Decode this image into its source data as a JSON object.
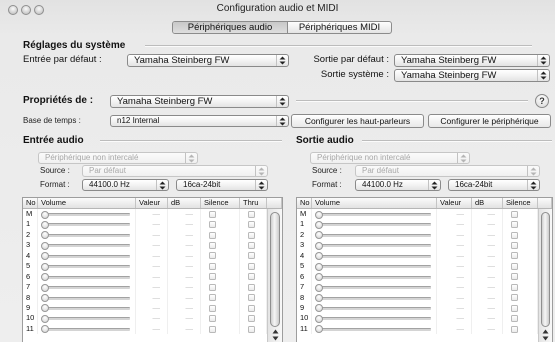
{
  "window": {
    "title": "Configuration audio et MIDI"
  },
  "tabs": [
    {
      "label": "Périphériques audio",
      "selected": true
    },
    {
      "label": "Périphériques MIDI",
      "selected": false
    }
  ],
  "system_settings": {
    "heading": "Réglages du système",
    "default_input": {
      "label": "Entrée par défaut :",
      "value": "Yamaha Steinberg FW"
    },
    "default_output": {
      "label": "Sortie par défaut :",
      "value": "Yamaha Steinberg FW"
    },
    "system_output": {
      "label": "Sortie système :",
      "value": "Yamaha Steinberg FW"
    }
  },
  "properties": {
    "label": "Propriétés de :",
    "device": "Yamaha Steinberg FW",
    "help_label": "?",
    "clock": {
      "label": "Base de temps :",
      "value": "n12 Internal"
    },
    "speakers_button": "Configurer les haut-parleurs",
    "device_button": "Configurer le périphérique"
  },
  "input": {
    "heading": "Entrée audio",
    "stream": {
      "value": "Périphérique non intercalé",
      "enabled": false
    },
    "source": {
      "label": "Source :",
      "value": "Par défaut",
      "enabled": false
    },
    "format": {
      "label": "Format :",
      "rate": "44100.0 Hz",
      "bits": "16ca-24bit"
    },
    "columns": [
      "No",
      "Volume",
      "Valeur",
      "dB",
      "Silence",
      "Thru"
    ],
    "channels": [
      {
        "no": "M",
        "volume": 0,
        "value": "—",
        "db": "—",
        "mute": false,
        "thru": false
      },
      {
        "no": "1",
        "volume": 0,
        "value": "—",
        "db": "—",
        "mute": false,
        "thru": false
      },
      {
        "no": "2",
        "volume": 0,
        "value": "—",
        "db": "—",
        "mute": false,
        "thru": false
      },
      {
        "no": "3",
        "volume": 0,
        "value": "—",
        "db": "—",
        "mute": false,
        "thru": false
      },
      {
        "no": "4",
        "volume": 0,
        "value": "—",
        "db": "—",
        "mute": false,
        "thru": false
      },
      {
        "no": "5",
        "volume": 0,
        "value": "—",
        "db": "—",
        "mute": false,
        "thru": false
      },
      {
        "no": "6",
        "volume": 0,
        "value": "—",
        "db": "—",
        "mute": false,
        "thru": false
      },
      {
        "no": "7",
        "volume": 0,
        "value": "—",
        "db": "—",
        "mute": false,
        "thru": false
      },
      {
        "no": "8",
        "volume": 0,
        "value": "—",
        "db": "—",
        "mute": false,
        "thru": false
      },
      {
        "no": "9",
        "volume": 0,
        "value": "—",
        "db": "—",
        "mute": false,
        "thru": false
      },
      {
        "no": "10",
        "volume": 0,
        "value": "—",
        "db": "—",
        "mute": false,
        "thru": false
      },
      {
        "no": "11",
        "volume": 0,
        "value": "—",
        "db": "—",
        "mute": false,
        "thru": false
      }
    ]
  },
  "output": {
    "heading": "Sortie audio",
    "stream": {
      "value": "Périphérique non intercalé",
      "enabled": false
    },
    "source": {
      "label": "Source :",
      "value": "Par défaut",
      "enabled": false
    },
    "format": {
      "label": "Format :",
      "rate": "44100.0 Hz",
      "bits": "16ca-24bit"
    },
    "columns": [
      "No",
      "Volume",
      "Valeur",
      "dB",
      "Silence"
    ],
    "channels": [
      {
        "no": "M",
        "volume": 0,
        "value": "—",
        "db": "—",
        "mute": false
      },
      {
        "no": "1",
        "volume": 0,
        "value": "—",
        "db": "—",
        "mute": false
      },
      {
        "no": "2",
        "volume": 0,
        "value": "—",
        "db": "—",
        "mute": false
      },
      {
        "no": "3",
        "volume": 0,
        "value": "—",
        "db": "—",
        "mute": false
      },
      {
        "no": "4",
        "volume": 0,
        "value": "—",
        "db": "—",
        "mute": false
      },
      {
        "no": "5",
        "volume": 0,
        "value": "—",
        "db": "—",
        "mute": false
      },
      {
        "no": "6",
        "volume": 0,
        "value": "—",
        "db": "—",
        "mute": false
      },
      {
        "no": "7",
        "volume": 0,
        "value": "—",
        "db": "—",
        "mute": false
      },
      {
        "no": "8",
        "volume": 0,
        "value": "—",
        "db": "—",
        "mute": false
      },
      {
        "no": "9",
        "volume": 0,
        "value": "—",
        "db": "—",
        "mute": false
      },
      {
        "no": "10",
        "volume": 0,
        "value": "—",
        "db": "—",
        "mute": false
      },
      {
        "no": "11",
        "volume": 0,
        "value": "—",
        "db": "—",
        "mute": false
      }
    ]
  }
}
